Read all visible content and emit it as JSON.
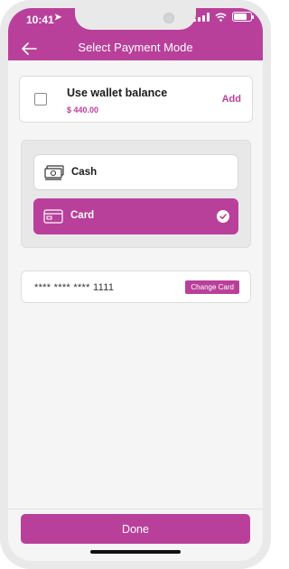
{
  "status": {
    "time": "10:41"
  },
  "header": {
    "title": "Select Payment Mode"
  },
  "wallet": {
    "title": "Use wallet balance",
    "amount": "$ 440.00",
    "add_label": "Add",
    "checked": false
  },
  "options": {
    "cash_label": "Cash",
    "card_label": "Card",
    "selected": "Card"
  },
  "saved_card": {
    "number": "**** **** **** 1111",
    "change_label": "Change Card"
  },
  "footer": {
    "done_label": "Done"
  },
  "colors": {
    "accent": "#b9409a",
    "background": "#f5f5f5",
    "panel": "#e8e8e8"
  },
  "icons": [
    "back-arrow-icon",
    "location-arrow-icon",
    "signal-icon",
    "wifi-icon",
    "battery-icon",
    "checkbox-icon",
    "cash-icon",
    "card-icon",
    "check-circle-icon"
  ]
}
